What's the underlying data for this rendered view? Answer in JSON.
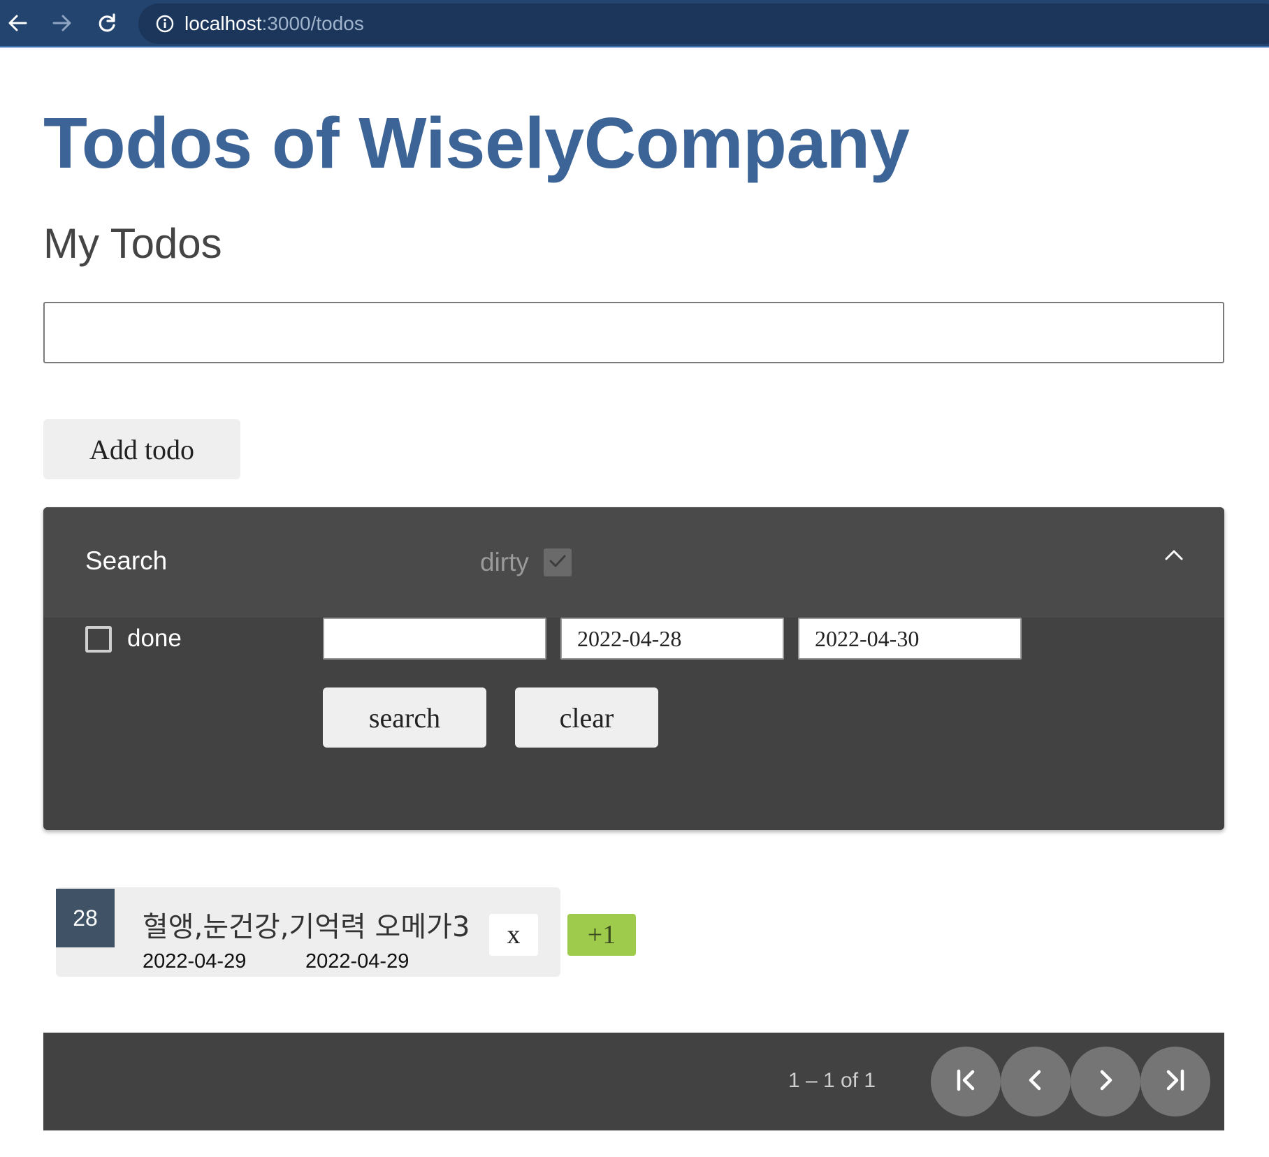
{
  "browser": {
    "url_host": "localhost",
    "url_path": ":3000/todos"
  },
  "header": {
    "app_title": "Todos of WiselyCompany",
    "section_title": "My Todos"
  },
  "new_todo": {
    "input_value": "",
    "add_label": "Add todo"
  },
  "search_panel": {
    "title": "Search",
    "dirty_label": "dirty",
    "dirty_checked": true,
    "expanded": true,
    "done_label": "done",
    "done_checked": false,
    "keyword_value": "",
    "start_date": "2022-04-28",
    "end_date": "2022-04-30",
    "search_label": "search",
    "clear_label": "clear"
  },
  "todos": [
    {
      "id": "28",
      "title": "혈앵,눈건강,기억력 오메가3",
      "created": "2022-04-29",
      "updated": "2022-04-29",
      "delete_label": "x"
    }
  ],
  "badge": {
    "label": "+1",
    "color": "#9ecb4c"
  },
  "paginator": {
    "range_label": "1 – 1 of 1"
  },
  "colors": {
    "browser_bar": "#23446f",
    "title_blue": "#3d6496",
    "panel_bg": "#424242",
    "id_badge": "#3f5266"
  }
}
